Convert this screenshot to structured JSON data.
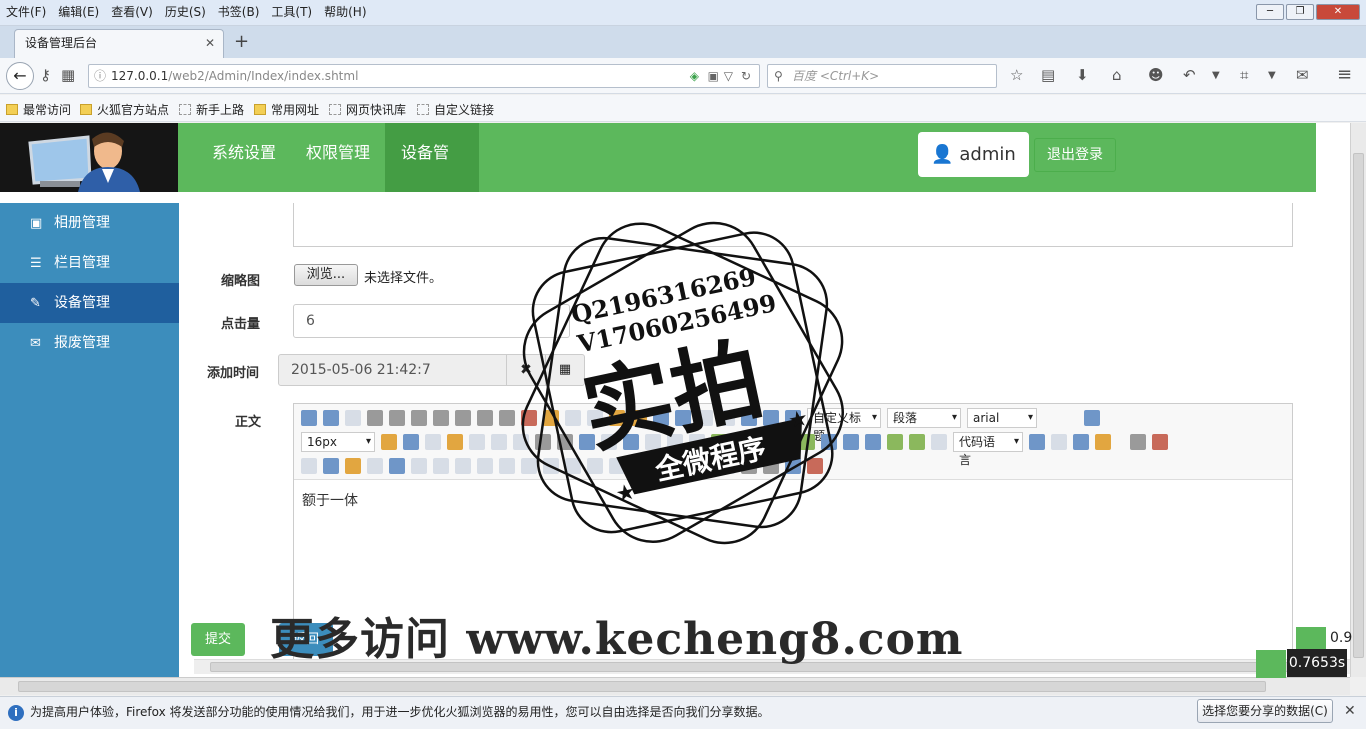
{
  "menubar": {
    "items": [
      "文件(F)",
      "编辑(E)",
      "查看(V)",
      "历史(S)",
      "书签(B)",
      "工具(T)",
      "帮助(H)"
    ]
  },
  "browser": {
    "tab_title": "设备管理后台",
    "url_host": "127.0.0.1",
    "url_path": "/web2/Admin/Index/index.shtml",
    "search_placeholder": "百度 <Ctrl+K>",
    "bookmarks": [
      "最常访问",
      "火狐官方站点",
      "新手上路",
      "常用网址",
      "网页快讯库",
      "自定义链接"
    ]
  },
  "header": {
    "nav": [
      "系统设置",
      "权限管理",
      "设备管理"
    ],
    "active_nav": "设备管理",
    "user": "admin",
    "logout": "退出登录"
  },
  "sidebar": {
    "items": [
      {
        "label": "相册管理",
        "icon": "picture-icon"
      },
      {
        "label": "栏目管理",
        "icon": "list-icon"
      },
      {
        "label": "设备管理",
        "icon": "edit-icon",
        "active": true
      },
      {
        "label": "报废管理",
        "icon": "envelope-icon"
      }
    ]
  },
  "form": {
    "thumb_label": "缩略图",
    "browse_label": "浏览...",
    "no_file": "未选择文件。",
    "clicks_label": "点击量",
    "clicks_value": "6",
    "time_label": "添加时间",
    "time_value": "2015-05-06 21:42:7",
    "body_label": "正文",
    "editor_selects": {
      "title": "自定义标题",
      "para": "段落",
      "font": "arial",
      "size": "16px",
      "code": "代码语言"
    },
    "editor_content": "额于一体",
    "submit": "提交",
    "back": "返回"
  },
  "notification": {
    "text": "为提高用户体验，Firefox 将发送部分功能的使用情况给我们，用于进一步优化火狐浏览器的易用性，您可以自由选择是否向我们分享数据。",
    "button": "选择您要分享的数据(C)"
  },
  "overlay": {
    "stamp_line1": "Q2196316269",
    "stamp_line2": "V17060256499",
    "stamp_big": "实拍",
    "stamp_banner": "全微程序",
    "watermark": "更多访问 www.kecheng8.com",
    "timer": "0.7653s",
    "timer_partial": "0.9"
  },
  "colors": {
    "green": "#5cb85c",
    "green_active": "#449d44",
    "blue": "#3c8dbc",
    "blue_active": "#1f5f9e"
  }
}
